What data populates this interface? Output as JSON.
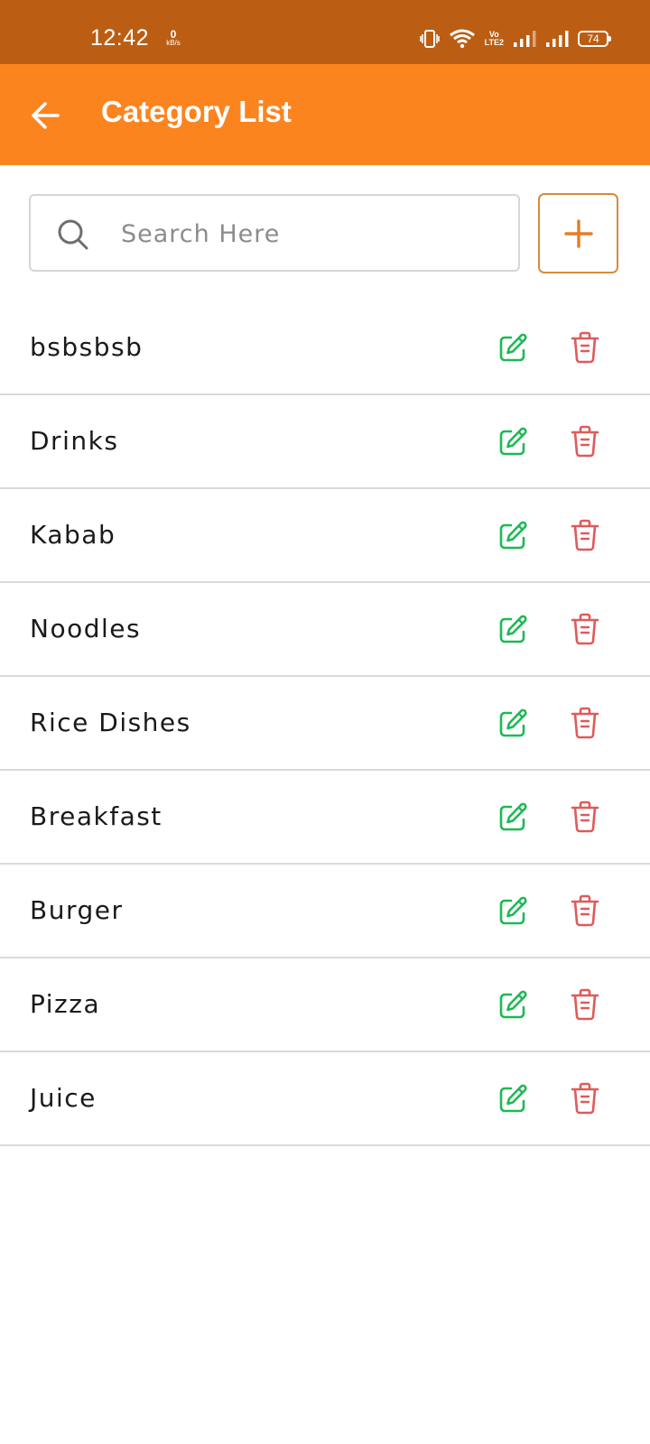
{
  "status_bar": {
    "time": "12:42",
    "speed_value": "0",
    "speed_unit": "kB/s",
    "network": "Vo LTE2",
    "battery": "74",
    "icons": [
      "vibrate-icon",
      "wifi-icon",
      "volte-icon",
      "signal-icon",
      "signal-icon",
      "battery-icon"
    ]
  },
  "app_bar": {
    "title": "Category List",
    "back_icon": "arrow-left-icon"
  },
  "search": {
    "placeholder": "Search Here",
    "value": ""
  },
  "add_button": {
    "icon": "plus-icon"
  },
  "categories": [
    {
      "name": "bsbsbsb"
    },
    {
      "name": "Drinks"
    },
    {
      "name": "Kabab"
    },
    {
      "name": "Noodles"
    },
    {
      "name": "Rice Dishes"
    },
    {
      "name": "Breakfast"
    },
    {
      "name": "Burger"
    },
    {
      "name": "Pizza"
    },
    {
      "name": "Juice"
    }
  ],
  "colors": {
    "status_bar": "#BB5E13",
    "app_bar": "#FC841F",
    "edit": "#1DB954",
    "delete": "#E05A5A",
    "add_border": "#D98A3D",
    "add_plus": "#E67E22"
  }
}
